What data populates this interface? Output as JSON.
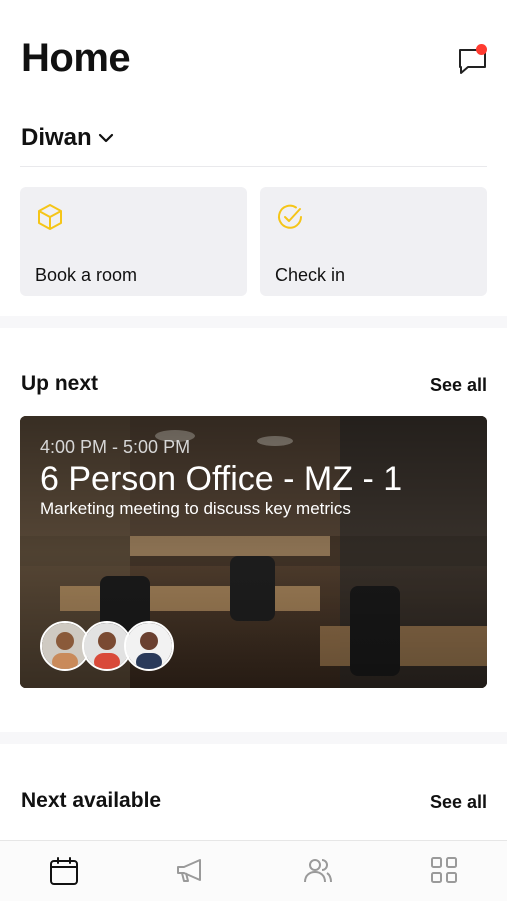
{
  "header": {
    "title": "Home"
  },
  "location": {
    "name": "Diwan"
  },
  "quick_actions": [
    {
      "label": "Book a room",
      "icon": "cube-icon"
    },
    {
      "label": "Check in",
      "icon": "check-circle-icon"
    }
  ],
  "up_next": {
    "title": "Up next",
    "see_all": "See all",
    "booking": {
      "time": "4:00 PM - 5:00 PM",
      "room": "6 Person Office - MZ - 1",
      "description": "Marketing meeting to discuss key metrics"
    }
  },
  "next_available": {
    "title": "Next available",
    "see_all": "See all"
  },
  "tabbar": {
    "tabs": [
      {
        "icon": "calendar-icon"
      },
      {
        "icon": "megaphone-icon"
      },
      {
        "icon": "people-icon"
      },
      {
        "icon": "grid-icon"
      }
    ]
  },
  "colors": {
    "accent": "#f5c518",
    "notification_dot": "#ff3b30"
  }
}
